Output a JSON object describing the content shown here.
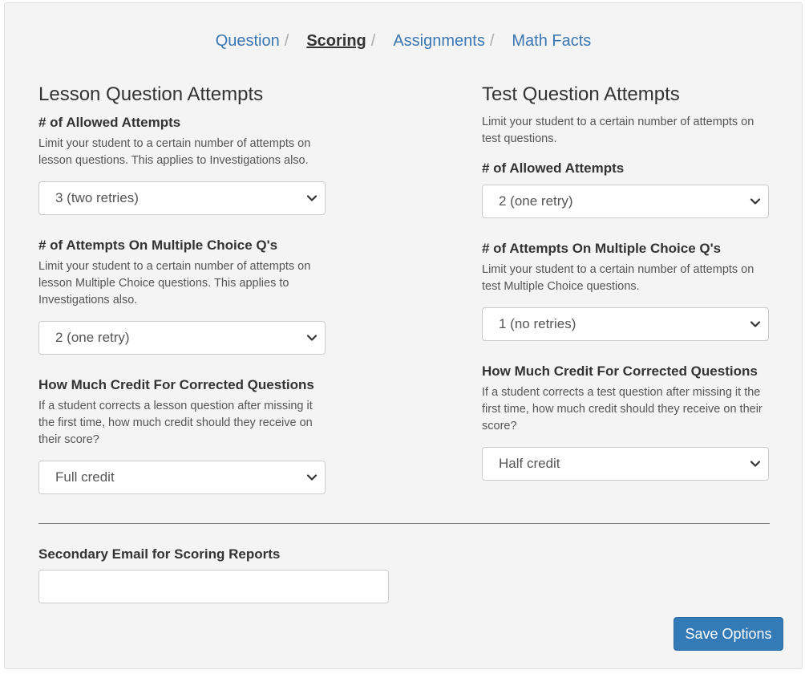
{
  "tabs": {
    "question": "Question",
    "scoring": "Scoring",
    "assignments": "Assignments",
    "math_facts": "Math Facts",
    "separator": "/"
  },
  "lesson": {
    "title": "Lesson Question Attempts",
    "intro": "",
    "allowed": {
      "label": "# of Allowed Attempts",
      "help": "Limit your student to a certain number of attempts on lesson questions. This applies to Investigations also.",
      "value": "3 (two retries)"
    },
    "multiple_choice": {
      "label": "# of Attempts On Multiple Choice Q's",
      "help": "Limit your student to a certain number of attempts on lesson Multiple Choice questions. This applies to Investigations also.",
      "value": "2 (one retry)"
    },
    "credit": {
      "label": "How Much Credit For Corrected Questions",
      "help": "If a student corrects a lesson question after missing it the first time, how much credit should they receive on their score?",
      "value": "Full credit"
    }
  },
  "test": {
    "title": "Test Question Attempts",
    "intro": "Limit your student to a certain number of attempts on test questions.",
    "allowed": {
      "label": "# of Allowed Attempts",
      "value": "2 (one retry)"
    },
    "multiple_choice": {
      "label": "# of Attempts On Multiple Choice Q's",
      "help": "Limit your student to a certain number of attempts on test Multiple Choice questions.",
      "value": "1 (no retries)"
    },
    "credit": {
      "label": "How Much Credit For Corrected Questions",
      "help": "If a student corrects a test question after missing it the first time, how much credit should they receive on their score?",
      "value": "Half credit"
    }
  },
  "email": {
    "label": "Secondary Email for Scoring Reports",
    "value": "",
    "placeholder": ""
  },
  "actions": {
    "save_label": "Save Options"
  },
  "colors": {
    "link": "#3a77b3",
    "primary_button": "#337ab7",
    "panel_background": "#f4f4f4"
  },
  "icons": {
    "select_arrow": "chevron-down-icon"
  }
}
